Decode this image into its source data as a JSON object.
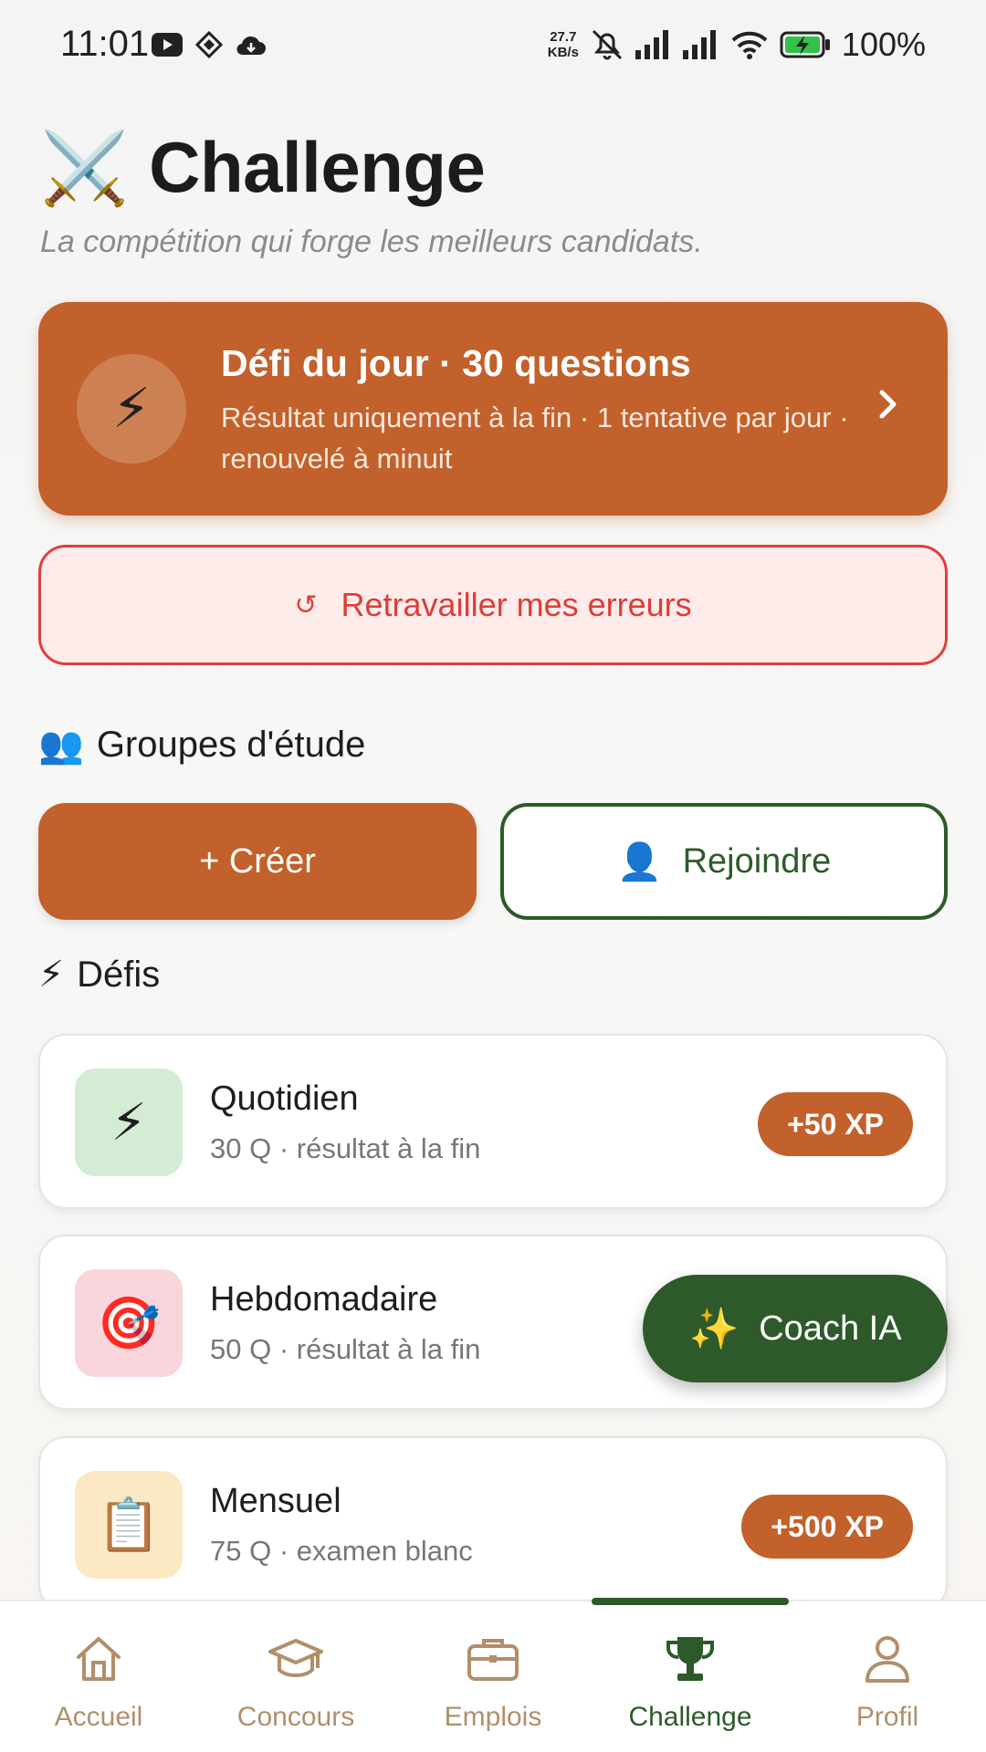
{
  "status_bar": {
    "time": "11:01",
    "speed_value": "27.7",
    "speed_unit": "KB/s",
    "battery": "100%",
    "icons": [
      "youtube-icon",
      "app-icon",
      "cloud-icon",
      "mute-icon",
      "signal-icon",
      "signal-icon",
      "wifi-icon",
      "battery-charging-icon"
    ]
  },
  "header": {
    "emoji": "⚔️",
    "title": "Challenge",
    "subtitle": "La compétition qui forge les meilleurs candidats."
  },
  "daily_challenge": {
    "icon": "⚡",
    "title": "Défi du jour · 30 questions",
    "description": "Résultat uniquement à la fin · 1 tentative par jour · renouvelé à minuit"
  },
  "errors_button": {
    "icon": "↺",
    "label": "Retravailler mes erreurs"
  },
  "groups": {
    "emoji": "👥",
    "title": "Groupes d'étude",
    "create_label": "+ Créer",
    "join_icon": "👤",
    "join_label": "Rejoindre"
  },
  "challenges": {
    "emoji": "⚡",
    "title": "Défis",
    "items": [
      {
        "icon": "⚡",
        "name": "Quotidien",
        "meta": "30 Q · résultat à la fin",
        "xp": "+50 XP",
        "icon_bg": "#d5ecd4"
      },
      {
        "icon": "🎯",
        "name": "Hebdomadaire",
        "meta": "50 Q · résultat à la fin",
        "xp": "",
        "icon_bg": "#f9d6dc"
      },
      {
        "icon": "📋",
        "name": "Mensuel",
        "meta": "75 Q · examen blanc",
        "xp": "+500 XP",
        "icon_bg": "#fbe9c3"
      }
    ]
  },
  "coach": {
    "emoji": "✨",
    "label": "Coach IA"
  },
  "bottom_nav": {
    "items": [
      {
        "label": "Accueil",
        "icon": "home-icon"
      },
      {
        "label": "Concours",
        "icon": "graduation-cap-icon"
      },
      {
        "label": "Emplois",
        "icon": "briefcase-icon"
      },
      {
        "label": "Challenge",
        "icon": "trophy-icon",
        "active": true
      },
      {
        "label": "Profil",
        "icon": "user-icon"
      }
    ]
  },
  "colors": {
    "primary": "#c2612b",
    "green": "#2e5a2b",
    "error": "#e23e3a",
    "nav_inactive": "#b18f6b"
  }
}
